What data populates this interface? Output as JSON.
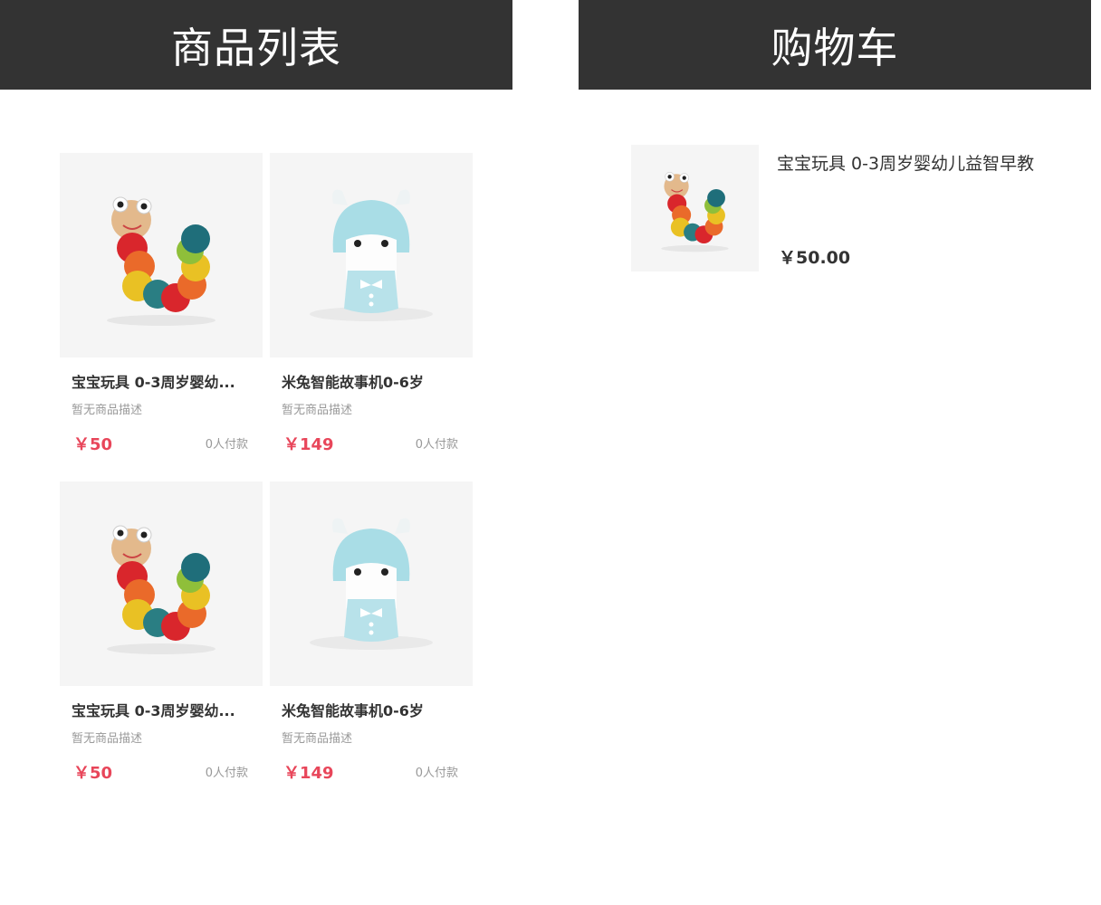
{
  "product_list_header": {
    "title": "商品列表"
  },
  "cart_header": {
    "title": "购物车"
  },
  "products": [
    {
      "name": "宝宝玩具 0-3周岁婴幼...",
      "description": "暂无商品描述",
      "price": "￥50",
      "sold": "0人付款",
      "image": "caterpillar-toy"
    },
    {
      "name": "米兔智能故事机0-6岁",
      "description": "暂无商品描述",
      "price": "￥149",
      "sold": "0人付款",
      "image": "mitu-story-machine"
    },
    {
      "name": "宝宝玩具 0-3周岁婴幼...",
      "description": "暂无商品描述",
      "price": "￥50",
      "sold": "0人付款",
      "image": "caterpillar-toy"
    },
    {
      "name": "米兔智能故事机0-6岁",
      "description": "暂无商品描述",
      "price": "￥149",
      "sold": "0人付款",
      "image": "mitu-story-machine"
    }
  ],
  "cart": {
    "items": [
      {
        "title": "宝宝玩具 0-3周岁婴幼儿益智早教",
        "price": "￥50.00",
        "image": "caterpillar-toy"
      }
    ]
  },
  "colors": {
    "header_bg": "#333333",
    "price_red": "#e8465a",
    "thumb_bg": "#f5f5f5"
  }
}
